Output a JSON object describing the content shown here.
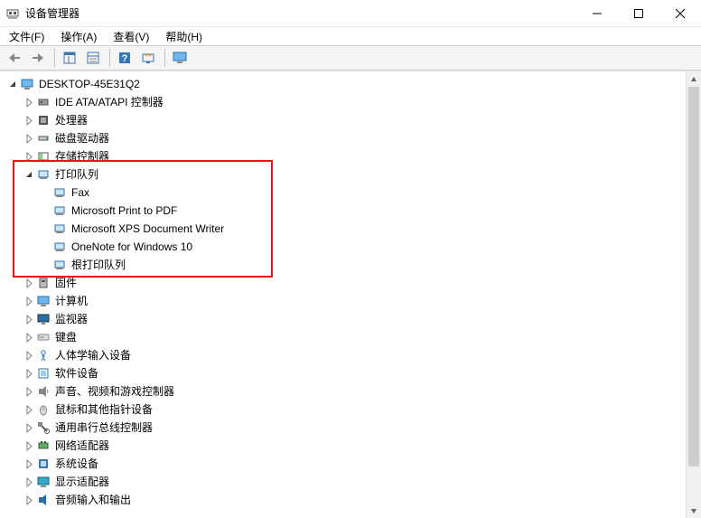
{
  "title": "设备管理器",
  "menu": {
    "file": "文件(F)",
    "action": "操作(A)",
    "view": "查看(V)",
    "help": "帮助(H)"
  },
  "root": "DESKTOP-45E31Q2",
  "categories": [
    {
      "label": "IDE ATA/ATAPI 控制器",
      "expanded": false
    },
    {
      "label": "处理器",
      "expanded": false
    },
    {
      "label": "磁盘驱动器",
      "expanded": false
    },
    {
      "label": "存储控制器",
      "expanded": false
    },
    {
      "label": "打印队列",
      "expanded": true,
      "children": [
        "Fax",
        "Microsoft Print to PDF",
        "Microsoft XPS Document Writer",
        "OneNote for Windows 10",
        "根打印队列"
      ]
    },
    {
      "label": "固件",
      "expanded": false
    },
    {
      "label": "计算机",
      "expanded": false
    },
    {
      "label": "监视器",
      "expanded": false
    },
    {
      "label": "键盘",
      "expanded": false
    },
    {
      "label": "人体学输入设备",
      "expanded": false
    },
    {
      "label": "软件设备",
      "expanded": false
    },
    {
      "label": "声音、视频和游戏控制器",
      "expanded": false
    },
    {
      "label": "鼠标和其他指针设备",
      "expanded": false
    },
    {
      "label": "通用串行总线控制器",
      "expanded": false
    },
    {
      "label": "网络适配器",
      "expanded": false
    },
    {
      "label": "系统设备",
      "expanded": false
    },
    {
      "label": "显示适配器",
      "expanded": false
    },
    {
      "label": "音频输入和输出",
      "expanded": false
    }
  ]
}
